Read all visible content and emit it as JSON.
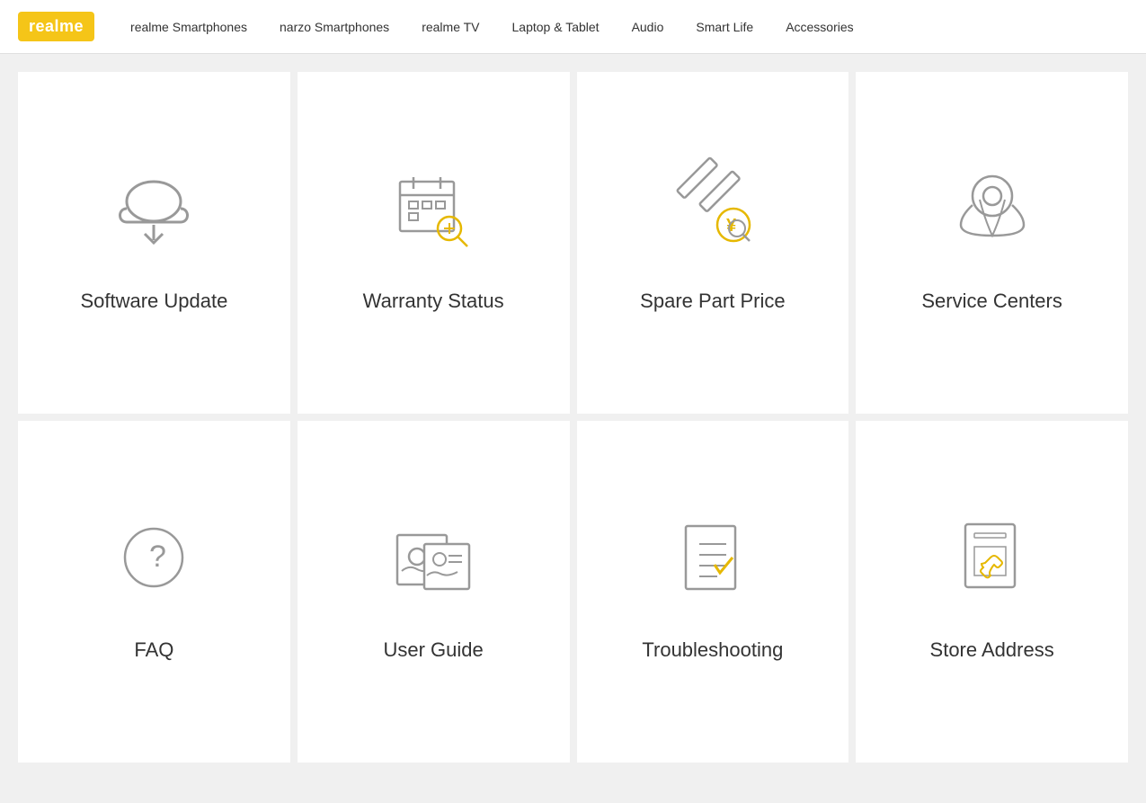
{
  "header": {
    "logo": "realme",
    "nav": [
      {
        "label": "realme Smartphones",
        "id": "realme-smartphones"
      },
      {
        "label": "narzo Smartphones",
        "id": "narzo-smartphones"
      },
      {
        "label": "realme TV",
        "id": "realme-tv"
      },
      {
        "label": "Laptop & Tablet",
        "id": "laptop-tablet"
      },
      {
        "label": "Audio",
        "id": "audio"
      },
      {
        "label": "Smart Life",
        "id": "smart-life"
      },
      {
        "label": "Accessories",
        "id": "accessories"
      }
    ]
  },
  "cards": [
    {
      "id": "software-update",
      "label": "Software Update",
      "icon": "cloud-download"
    },
    {
      "id": "warranty-status",
      "label": "Warranty Status",
      "icon": "calendar-search"
    },
    {
      "id": "spare-part-price",
      "label": "Spare Part Price",
      "icon": "tool-price"
    },
    {
      "id": "service-centers",
      "label": "Service Centers",
      "icon": "location-pin"
    },
    {
      "id": "faq",
      "label": "FAQ",
      "icon": "question-circle"
    },
    {
      "id": "user-guide",
      "label": "User Guide",
      "icon": "id-card"
    },
    {
      "id": "troubleshooting",
      "label": "Troubleshooting",
      "icon": "checklist"
    },
    {
      "id": "store-address",
      "label": "Store Address",
      "icon": "store-phone"
    }
  ]
}
